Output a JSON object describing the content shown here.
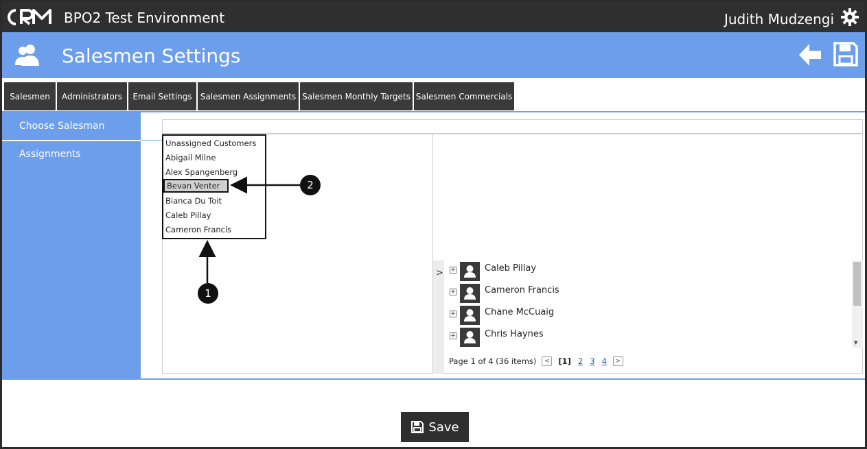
{
  "topbar": {
    "logo_text": "CRM",
    "env_title": "BPO2 Test Environment",
    "user_name": "Judith Mudzengi",
    "icons": {
      "settings": "gear-icon"
    }
  },
  "header": {
    "title": "Salesmen Settings",
    "icons": {
      "section": "users-icon",
      "back": "arrow-left-icon",
      "save": "floppy-disk-icon"
    }
  },
  "tabs": [
    {
      "label": "Salesmen"
    },
    {
      "label": "Administrators"
    },
    {
      "label": "Email Settings"
    },
    {
      "label": "Salesmen Assignments",
      "active": true
    },
    {
      "label": "Salesmen Monthly Targets"
    },
    {
      "label": "Salesmen Commercials"
    }
  ],
  "sidebar": {
    "items": [
      {
        "label": "Choose Salesman"
      },
      {
        "label": "Assignments"
      }
    ]
  },
  "salesman_list": {
    "items": [
      "Unassigned Customers",
      "Abigail Milne",
      "Alex Spangenberg",
      "Bevan Venter",
      "Bianca Du Toit",
      "Caleb Pillay",
      "Cameron Francis"
    ],
    "selected": "Bevan Venter"
  },
  "assignments": {
    "expand_label": ">",
    "rows": [
      {
        "name": "Caleb Pillay"
      },
      {
        "name": "Cameron Francis"
      },
      {
        "name": "Chane McCuaig"
      },
      {
        "name": "Chris Haynes"
      }
    ],
    "pager": {
      "summary": "Page 1 of 4 (36 items)",
      "current": "[1]",
      "pages": [
        "2",
        "3",
        "4"
      ]
    }
  },
  "footer": {
    "save_label": "Save"
  },
  "callouts": [
    "1",
    "2"
  ],
  "colors": {
    "topbar": "#2f2f2f",
    "accent": "#6d9eeb",
    "tab": "#3a3a3a"
  }
}
